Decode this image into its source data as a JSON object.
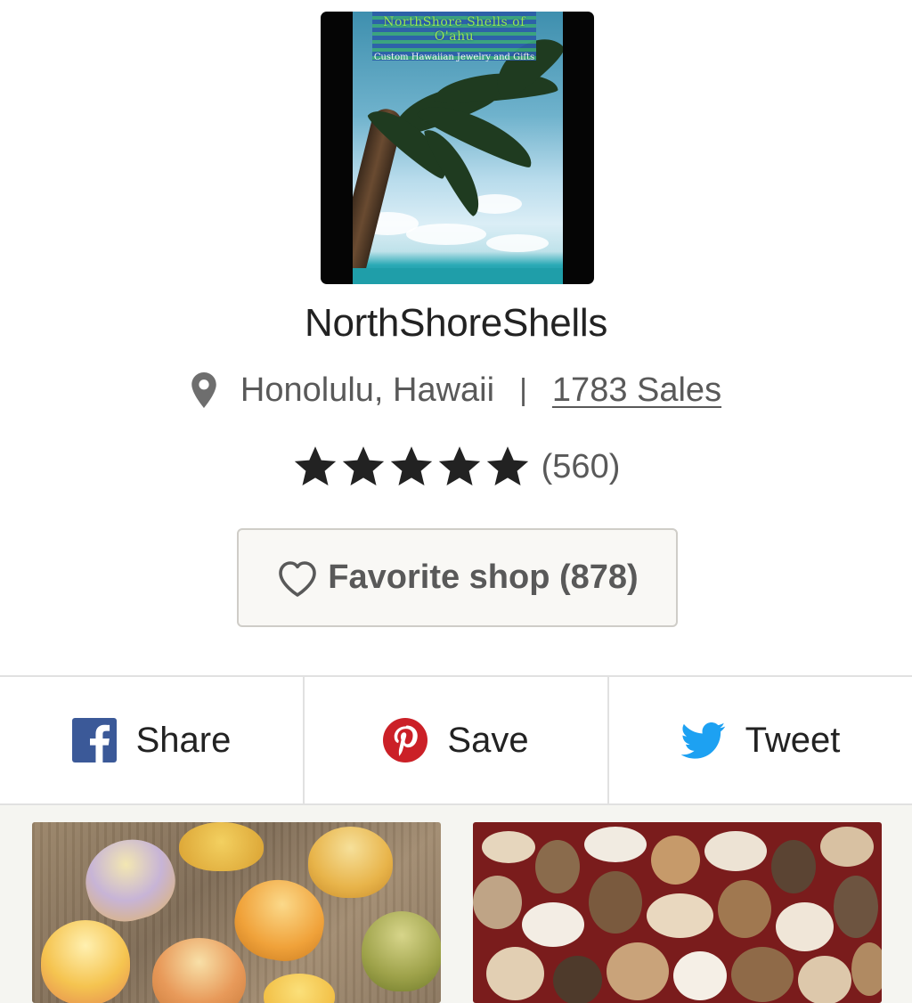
{
  "shop": {
    "logo_title": "NorthShore Shells of O'ahu",
    "logo_subtitle": "Custom Hawaiian Jewelry and Gifts",
    "name": "NorthShoreShells",
    "location": "Honolulu, Hawaii",
    "separator": "|",
    "sales": "1783 Sales",
    "rating_stars": 5,
    "review_count": "(560)",
    "favorite_label": "Favorite shop (878)"
  },
  "share_bar": {
    "facebook_label": "Share",
    "pinterest_label": "Save",
    "twitter_label": "Tweet"
  },
  "icons": {
    "location": "pin-icon",
    "star": "star-icon",
    "favorite": "heart-icon",
    "facebook": "facebook-icon",
    "pinterest": "pinterest-icon",
    "twitter": "twitter-icon"
  },
  "colors": {
    "text_dark": "#222222",
    "text_muted": "#595959",
    "facebook": "#3b5998",
    "pinterest": "#cb2027",
    "twitter": "#1da1f2",
    "button_bg": "#f9f8f5"
  }
}
